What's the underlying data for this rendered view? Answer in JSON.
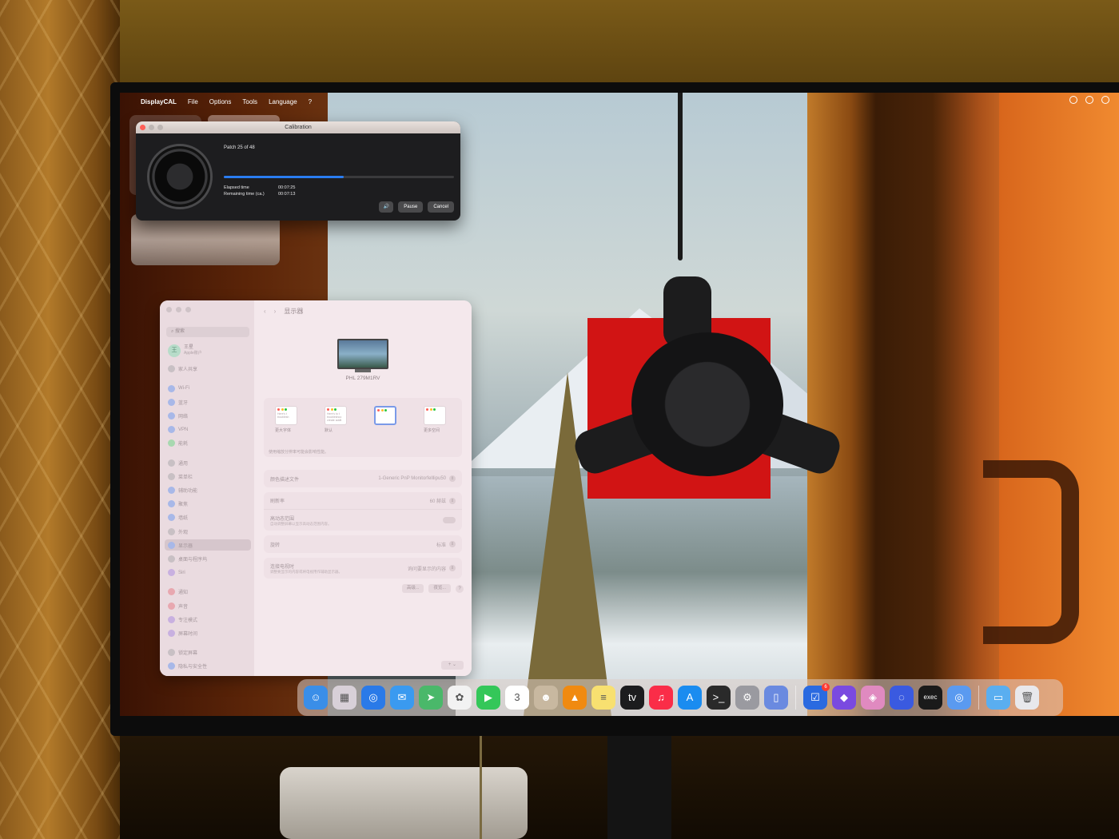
{
  "menubar": {
    "app_name": "DisplayCAL",
    "items": [
      "File",
      "Options",
      "Tools",
      "Language",
      "?"
    ]
  },
  "calibration": {
    "title": "Calibration",
    "patch_label": "Patch 25 of 48",
    "progress": 0.52,
    "elapsed_label": "Elapsed time",
    "elapsed_value": "00:07:25",
    "remaining_label": "Remaining time (ca.)",
    "remaining_value": "00:07:13",
    "pause_label": "Pause",
    "cancel_label": "Cancel"
  },
  "settings": {
    "title": "显示器",
    "search_placeholder": "搜索",
    "account_name": "王星",
    "account_sub": "Apple账户",
    "family": "家人共享",
    "sidebar_items": [
      {
        "label": "Wi-Fi"
      },
      {
        "label": "蓝牙"
      },
      {
        "label": "网络"
      },
      {
        "label": "VPN"
      },
      {
        "label": "能耗"
      },
      {
        "label": "通用"
      },
      {
        "label": "菜单栏"
      },
      {
        "label": "辅助功能"
      },
      {
        "label": "聚焦"
      },
      {
        "label": "墙纸"
      },
      {
        "label": "外观"
      },
      {
        "label": "显示器"
      },
      {
        "label": "桌面与程序坞"
      },
      {
        "label": "Siri"
      },
      {
        "label": "通知"
      },
      {
        "label": "声音"
      },
      {
        "label": "专注模式"
      },
      {
        "label": "屏幕时间"
      },
      {
        "label": "锁定屏幕"
      },
      {
        "label": "隐私与安全性"
      }
    ],
    "monitor_name": "PHL 279M1RV",
    "resolution_options": [
      {
        "preview": "Here's t troublesh",
        "label": "更大字体"
      },
      {
        "preview": "Here's to t troubleshoo create addit",
        "label": "默认"
      },
      {
        "preview": "",
        "label": ""
      },
      {
        "preview": "",
        "label": "更多空间"
      }
    ],
    "resolution_note": "使用缩放分辨率可能会影响性能。",
    "rows": {
      "color_profile_label": "颜色描述文件",
      "color_profile_value": "1-Generic PnP Monitorfelllipu50",
      "refresh_label": "刷新率",
      "refresh_value": "60 赫兹",
      "hdr_label": "高动态范围",
      "hdr_sub": "自动调整屏幕以显示高动态范围内容。",
      "rotation_label": "旋转",
      "rotation_value": "标准",
      "tv_label": "连接电视时",
      "tv_sub": "调整要显示的内容或将电视用作辅助显示器。",
      "tv_value": "询问要显示的内容"
    },
    "advanced_label": "高级...",
    "nightshift_label": "夜览...",
    "help_label": "?"
  },
  "dock": {
    "icons": [
      {
        "name": "finder",
        "glyph": "☺",
        "color": "#3a8ee8"
      },
      {
        "name": "launchpad",
        "glyph": "▦",
        "color": "#d8d0d8"
      },
      {
        "name": "safari",
        "glyph": "◎",
        "color": "#2a7ae8"
      },
      {
        "name": "mail",
        "glyph": "✉",
        "color": "#3a9af0"
      },
      {
        "name": "maps",
        "glyph": "➤",
        "color": "#4ab86a"
      },
      {
        "name": "photos",
        "glyph": "✿",
        "color": "#f2f2f2"
      },
      {
        "name": "facetime",
        "glyph": "▶",
        "color": "#34c759"
      },
      {
        "name": "calendar",
        "glyph": "3",
        "color": "#ffffff"
      },
      {
        "name": "contacts",
        "glyph": "☻",
        "color": "#c8b8a0"
      },
      {
        "name": "vlc",
        "glyph": "▲",
        "color": "#f08a10"
      },
      {
        "name": "notes",
        "glyph": "≡",
        "color": "#f8e070"
      },
      {
        "name": "tv",
        "glyph": "tv",
        "color": "#1c1c1e"
      },
      {
        "name": "music",
        "glyph": "♫",
        "color": "#fa2d48"
      },
      {
        "name": "app-store",
        "glyph": "A",
        "color": "#1a8cf0"
      },
      {
        "name": "terminal",
        "glyph": ">_",
        "color": "#2a2a2a"
      },
      {
        "name": "system-settings",
        "glyph": "⚙",
        "color": "#9a9aa0"
      },
      {
        "name": "simulator",
        "glyph": "▯",
        "color": "#6a8ae0"
      },
      {
        "name": "things",
        "glyph": "☑",
        "color": "#2a6ae0",
        "badge": "6"
      },
      {
        "name": "obsidian",
        "glyph": "◆",
        "color": "#7a4ae0"
      },
      {
        "name": "craft",
        "glyph": "◈",
        "color": "#e08ac0"
      },
      {
        "name": "arc",
        "glyph": "◌",
        "color": "#3a5ae0"
      },
      {
        "name": "exec",
        "glyph": "exec",
        "color": "#1a1a1a"
      },
      {
        "name": "safari-tech",
        "glyph": "◎",
        "color": "#5a9af0"
      },
      {
        "name": "downloads-folder",
        "glyph": "▭",
        "color": "#5aaef0"
      },
      {
        "name": "trash",
        "glyph": "🗑",
        "color": "#e8e8ec"
      }
    ]
  },
  "colors": {
    "accent": "#2a7cf0",
    "patch": "#d11414"
  }
}
